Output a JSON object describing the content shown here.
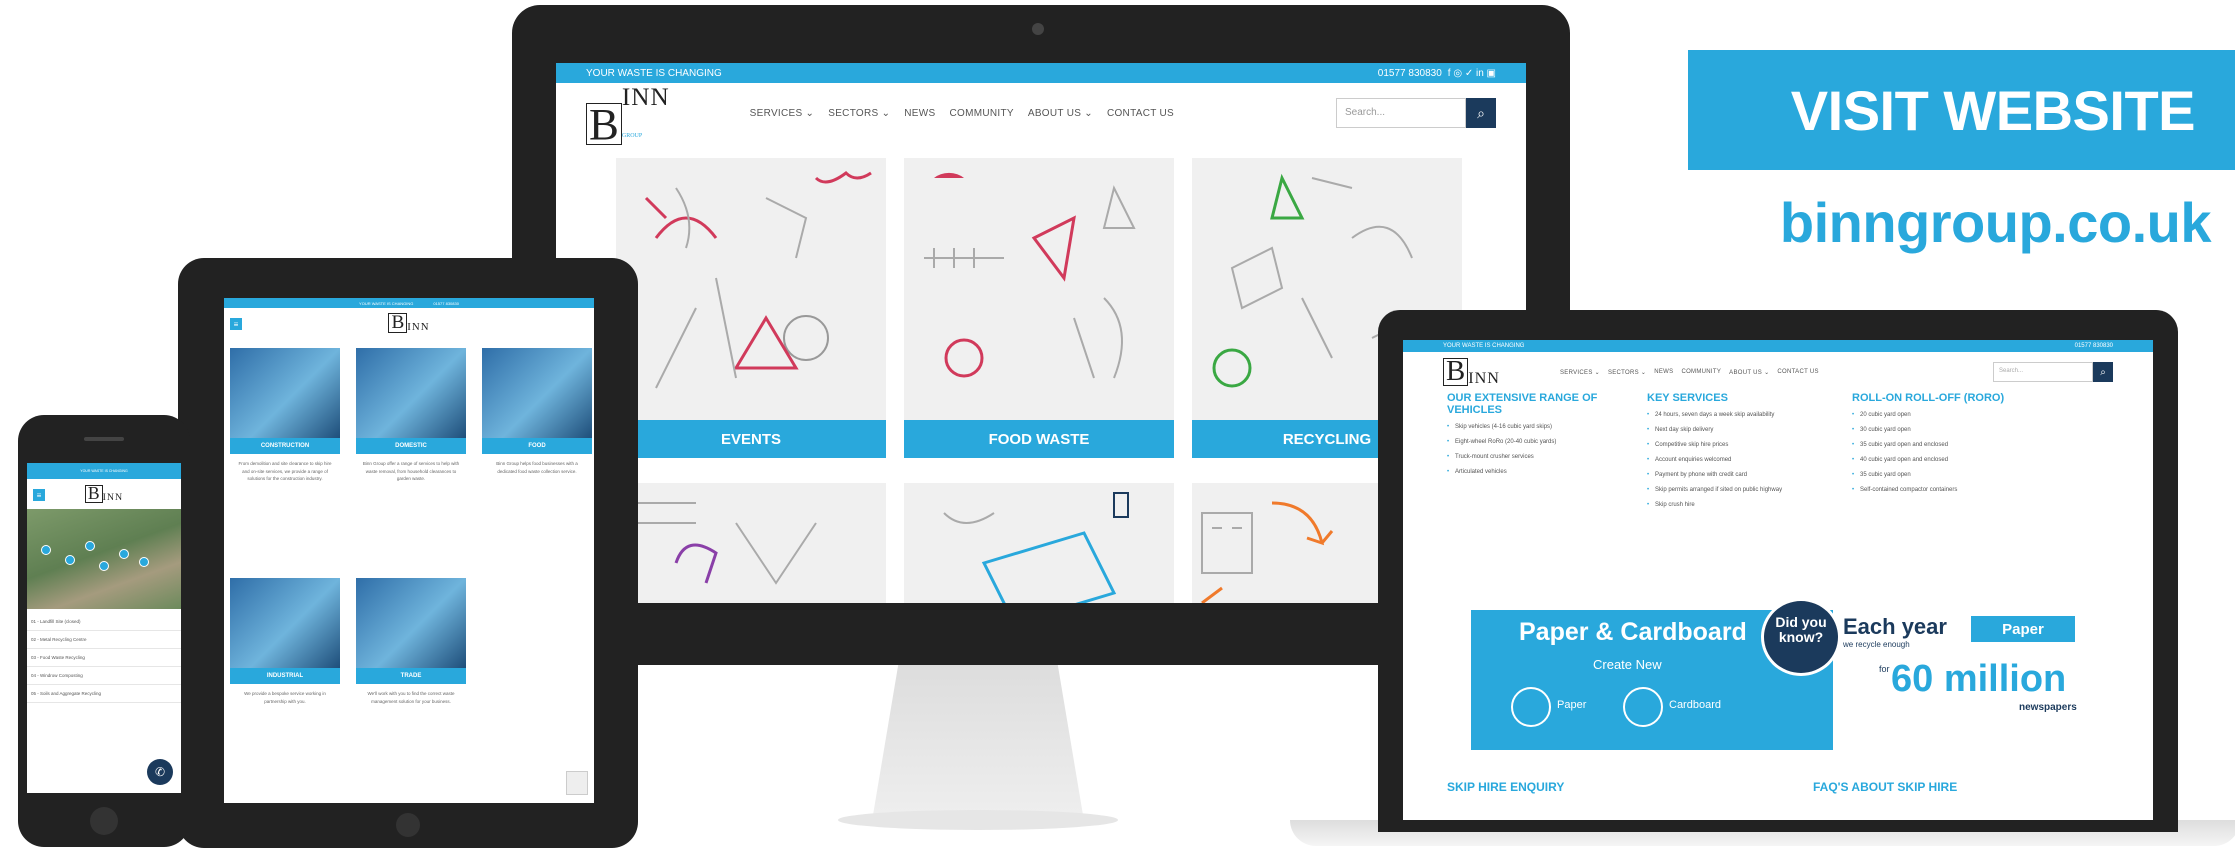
{
  "cta": {
    "button_label": "VISIT WEBSITE",
    "url": "binngroup.co.uk"
  },
  "site": {
    "tagline": "YOUR WASTE IS CHANGING",
    "phone": "01577 830830",
    "social": "f ◎ ✓ in ▣",
    "search_placeholder": "Search...",
    "brand": {
      "letter": "B",
      "rest": "INN",
      "sub": "GROUP"
    },
    "nav": [
      "SERVICES ⌄",
      "SECTORS ⌄",
      "NEWS",
      "COMMUNITY",
      "ABOUT US ⌄",
      "CONTACT US"
    ]
  },
  "desktop": {
    "tiles": [
      {
        "label": "EVENTS"
      },
      {
        "label": "FOOD WASTE"
      },
      {
        "label": "RECYCLING"
      }
    ]
  },
  "laptop": {
    "columns": [
      {
        "heading": "OUR EXTENSIVE RANGE OF VEHICLES",
        "items": [
          "Skip vehicles (4-16 cubic yard skips)",
          "Eight-wheel RoRo (20-40 cubic yards)",
          "Truck-mount crusher services",
          "Articulated vehicles"
        ]
      },
      {
        "heading": "KEY SERVICES",
        "items": [
          "24 hours, seven days a week skip availability",
          "Next day skip delivery",
          "Competitive skip hire prices",
          "Account enquiries welcomed",
          "Payment by phone with credit card",
          "Skip permits arranged if sited on public highway",
          "Skip crush hire"
        ]
      },
      {
        "heading": "ROLL-ON ROLL-OFF (RORO)",
        "items": [
          "20 cubic yard open",
          "30 cubic yard open",
          "35 cubic yard open and enclosed",
          "40 cubic yard open and enclosed",
          "35 cubic yard open",
          "Self-contained compactor containers"
        ]
      }
    ],
    "banner": {
      "title": "Paper & Cardboard",
      "subtitle": "Create New",
      "left_label": "Paper",
      "right_label": "Cardboard",
      "bubble": "Did you know?",
      "each_year": "Each year",
      "we_recycle": "we recycle enough",
      "tag": "Paper",
      "for": "for",
      "million": "60 million",
      "newspapers": "newspapers"
    },
    "footer_left": "SKIP HIRE ENQUIRY",
    "footer_right": "FAQ'S ABOUT SKIP HIRE"
  },
  "tablet": {
    "cards": [
      {
        "caption": "CONSTRUCTION",
        "text": "From demolition and site clearance to skip hire and on-site services, we provide a range of solutions for the construction industry."
      },
      {
        "caption": "DOMESTIC",
        "text": "Binn Group offer a range of services to help with waste removal, from household clearances to garden waste."
      },
      {
        "caption": "FOOD",
        "text": "Binn Group helps food businesses with a dedicated food waste collection service."
      },
      {
        "caption": "INDUSTRIAL",
        "text": "We provide a bespoke service working in partnership with you."
      },
      {
        "caption": "TRADE",
        "text": "We'll work with you to find the correct waste management solution for your business."
      }
    ]
  },
  "phone": {
    "list": [
      "01 - Landfill Site (closed)",
      "02 - Metal Recycling Centre",
      "03 - Food Waste Recycling",
      "04 - Windrow Composting",
      "05 - Soils and Aggregate Recycling"
    ]
  }
}
